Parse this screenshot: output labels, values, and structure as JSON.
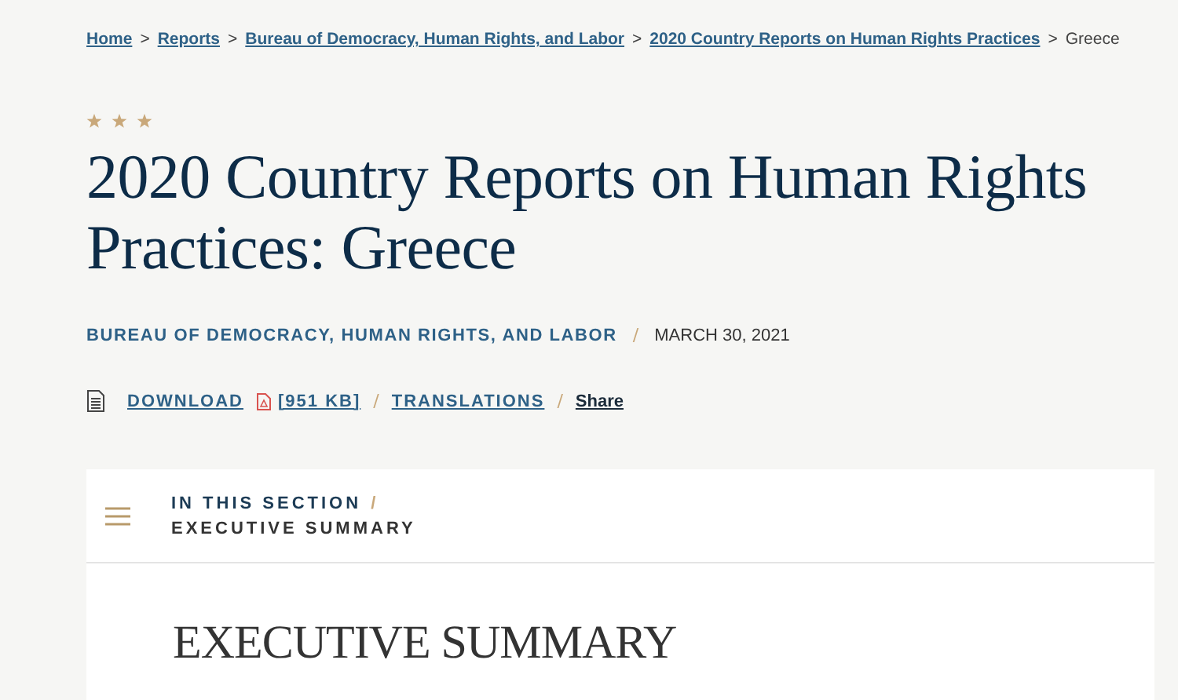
{
  "breadcrumb": {
    "links": [
      "Home",
      "Reports",
      "Bureau of Democracy, Human Rights, and Labor",
      "2020 Country Reports on Human Rights Practices"
    ],
    "separator": ">",
    "current": "Greece"
  },
  "title": "2020 Country Reports on Human Rights Practices: Greece",
  "meta": {
    "bureau": "BUREAU OF DEMOCRACY, HUMAN RIGHTS, AND LABOR",
    "separator": "/",
    "date": "MARCH 30, 2021"
  },
  "actions": {
    "download": "DOWNLOAD",
    "size": "[951 KB]",
    "translations": "TRANSLATIONS",
    "share": "Share",
    "separator": "/"
  },
  "section_nav": {
    "label": "IN THIS SECTION",
    "separator": "/",
    "current": "EXECUTIVE SUMMARY"
  },
  "section_heading": "EXECUTIVE SUMMARY"
}
